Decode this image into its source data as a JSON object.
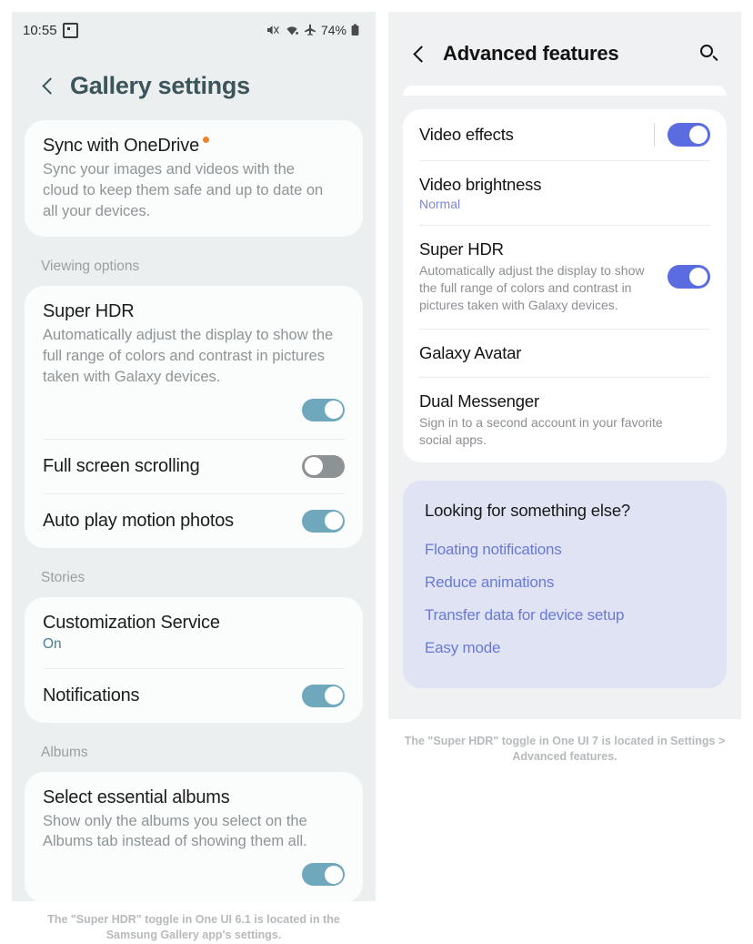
{
  "left_panel": {
    "status_bar": {
      "time": "10:55",
      "recording_icon": "screen-record-icon",
      "mute_icon": "mute-icon",
      "wifi_icon": "wifi-icon",
      "airplane_icon": "airplane-mode-icon",
      "battery_percent": "74%",
      "battery_icon": "battery-icon"
    },
    "header": {
      "back_icon": "chevron-left-icon",
      "title": "Gallery settings"
    },
    "onedrive": {
      "title": "Sync with OneDrive",
      "badge": "new-dot-badge",
      "description": "Sync your images and videos with the cloud to keep them safe and up to date on all your devices."
    },
    "sections": [
      {
        "label": "Viewing options",
        "rows": [
          {
            "title": "Super HDR",
            "description": "Automatically adjust the display to show the full range of colors and contrast in pictures taken with Galaxy devices.",
            "toggle": "on"
          },
          {
            "title": "Full screen scrolling",
            "toggle": "off"
          },
          {
            "title": "Auto play motion photos",
            "toggle": "on"
          }
        ]
      },
      {
        "label": "Stories",
        "rows": [
          {
            "title": "Customization Service",
            "sub": "On"
          },
          {
            "title": "Notifications",
            "toggle": "on"
          }
        ]
      },
      {
        "label": "Albums",
        "rows": [
          {
            "title": "Select essential albums",
            "description": "Show only the albums you select on the Albums tab instead of showing them all.",
            "toggle": "on"
          }
        ]
      }
    ],
    "caption": "The \"Super HDR\" toggle in One UI 6.1 is located in the Samsung Gallery app's settings."
  },
  "right_panel": {
    "header": {
      "back_icon": "chevron-left-icon",
      "title": "Advanced features",
      "search_icon": "search-icon"
    },
    "rows": [
      {
        "title": "Video effects",
        "toggle": "on",
        "has_divider": true
      },
      {
        "title": "Video brightness",
        "sub": "Normal"
      },
      {
        "title": "Super HDR",
        "description": "Automatically adjust the display to show the full range of colors and contrast in pictures taken with Galaxy devices.",
        "toggle": "on"
      },
      {
        "title": "Galaxy Avatar"
      },
      {
        "title": "Dual Messenger",
        "description": "Sign in to a second account in your favorite social apps."
      }
    ],
    "looking_card": {
      "title": "Looking for something else?",
      "links": [
        "Floating notifications",
        "Reduce animations",
        "Transfer data for device setup",
        "Easy mode"
      ]
    },
    "caption": "The \"Super HDR\" toggle in One UI 7 is located in Settings > Advanced features."
  },
  "colors": {
    "left_accent": "#3d555a",
    "left_toggle_on": "#6fa7bd",
    "left_toggle_off": "#8d9295",
    "right_toggle_on": "#5a6ce0",
    "right_link": "#6a7ad4",
    "badge_orange": "#f0822a",
    "looking_card_bg": "#e0e3f3"
  }
}
